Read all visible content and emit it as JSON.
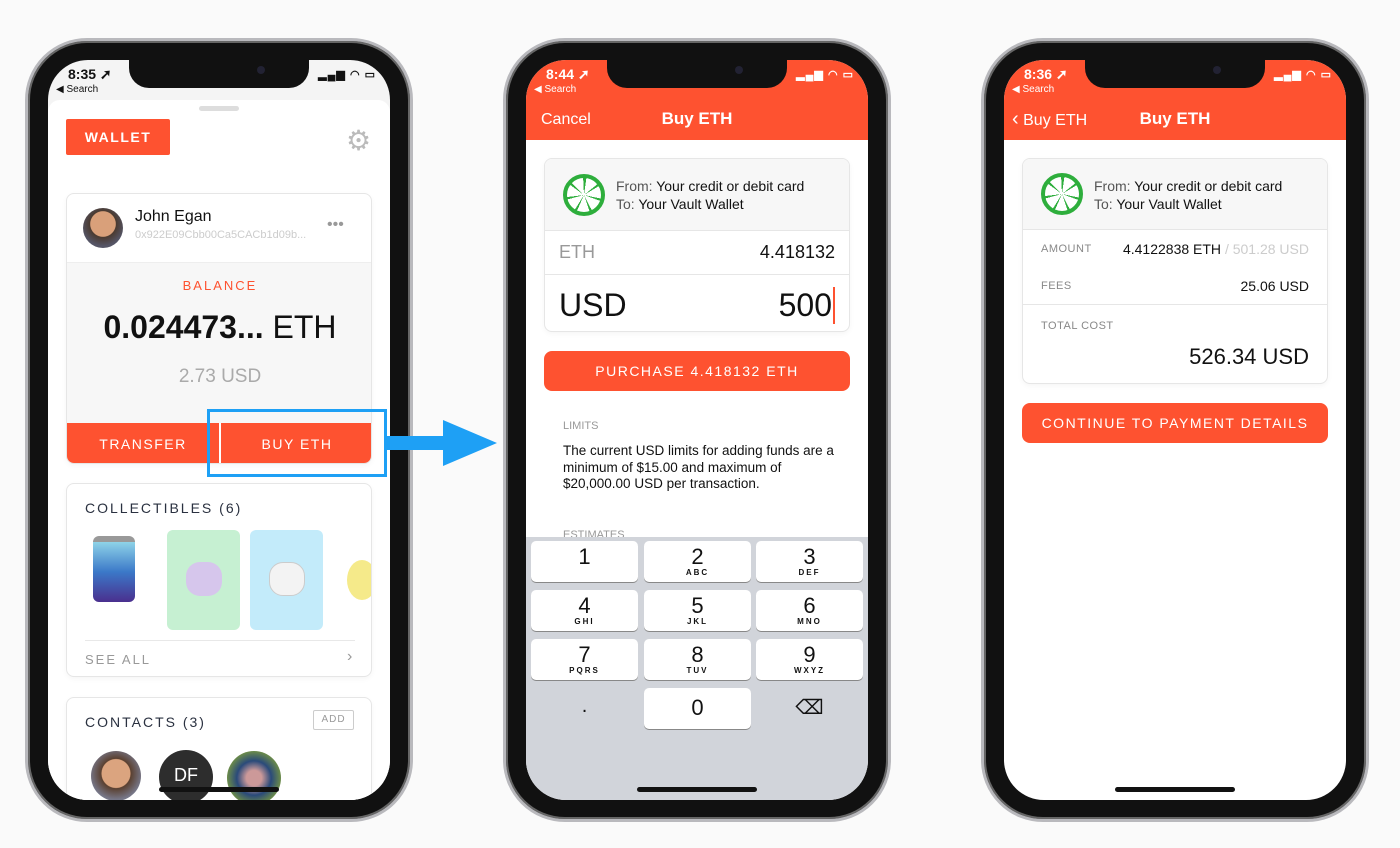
{
  "colors": {
    "accent": "#fe5230",
    "highlight": "#1ea0f5",
    "icon_green": "#2eae3c"
  },
  "phone1": {
    "status": {
      "time": "8:35 ➚",
      "back": "◀ Search",
      "indicators": "▂▄▆ ◠ ▭"
    },
    "wallet_button": "WALLET",
    "settings_icon": "gear-icon",
    "account": {
      "name": "John Egan",
      "address": "0x922E09Cbb00Ca5CACb1d09b...",
      "more": "•••"
    },
    "balance": {
      "label": "BALANCE",
      "amount": "0.024473...",
      "unit": "ETH",
      "usd": "2.73 USD"
    },
    "transfer_button": "TRANSFER",
    "buy_button": "BUY ETH",
    "collectibles": {
      "title": "COLLECTIBLES (6)",
      "see_all": "SEE ALL",
      "chevron": "›"
    },
    "contacts": {
      "title": "CONTACTS (3)",
      "add": "ADD",
      "initials": "DF"
    }
  },
  "phone2": {
    "status": {
      "time": "8:44 ➚",
      "back": "◀ Search",
      "indicators": "▂▄▆ ◠ ▭"
    },
    "cancel": "Cancel",
    "title": "Buy ETH",
    "from_label": "From:",
    "from_value": "Your credit or debit card",
    "to_label": "To:",
    "to_value": "Your Vault Wallet",
    "eth_label": "ETH",
    "eth_value": "4.418132",
    "usd_label": "USD",
    "usd_value": "500",
    "purchase_button": "PURCHASE 4.418132 ETH",
    "limits_label": "LIMITS",
    "limits_text": "The current USD limits for adding funds are a minimum of $15.00 and maximum of $20,000.00 USD per transaction.",
    "estimates_label": "ESTIMATES",
    "keypad": [
      {
        "d": "1",
        "l": ""
      },
      {
        "d": "2",
        "l": "ABC"
      },
      {
        "d": "3",
        "l": "DEF"
      },
      {
        "d": "4",
        "l": "GHI"
      },
      {
        "d": "5",
        "l": "JKL"
      },
      {
        "d": "6",
        "l": "MNO"
      },
      {
        "d": "7",
        "l": "PQRS"
      },
      {
        "d": "8",
        "l": "TUV"
      },
      {
        "d": "9",
        "l": "WXYZ"
      }
    ],
    "key_dot": ".",
    "key_zero": "0",
    "key_delete": "⌫"
  },
  "phone3": {
    "status": {
      "time": "8:36 ➚",
      "back": "◀ Search",
      "indicators": "▂▄▆ ◠ ▭"
    },
    "back_label": "Buy ETH",
    "title": "Buy ETH",
    "from_label": "From:",
    "from_value": "Your credit or debit card",
    "to_label": "To:",
    "to_value": "Your Vault Wallet",
    "amount_label": "AMOUNT",
    "amount_eth": "4.4122838",
    "amount_eth_unit": "ETH",
    "amount_usd": "/ 501.28 USD",
    "fees_label": "FEES",
    "fees_value": "25.06",
    "fees_unit": "USD",
    "total_label": "TOTAL COST",
    "total_value": "526.34",
    "total_unit": "USD",
    "continue_button": "CONTINUE TO PAYMENT DETAILS"
  }
}
